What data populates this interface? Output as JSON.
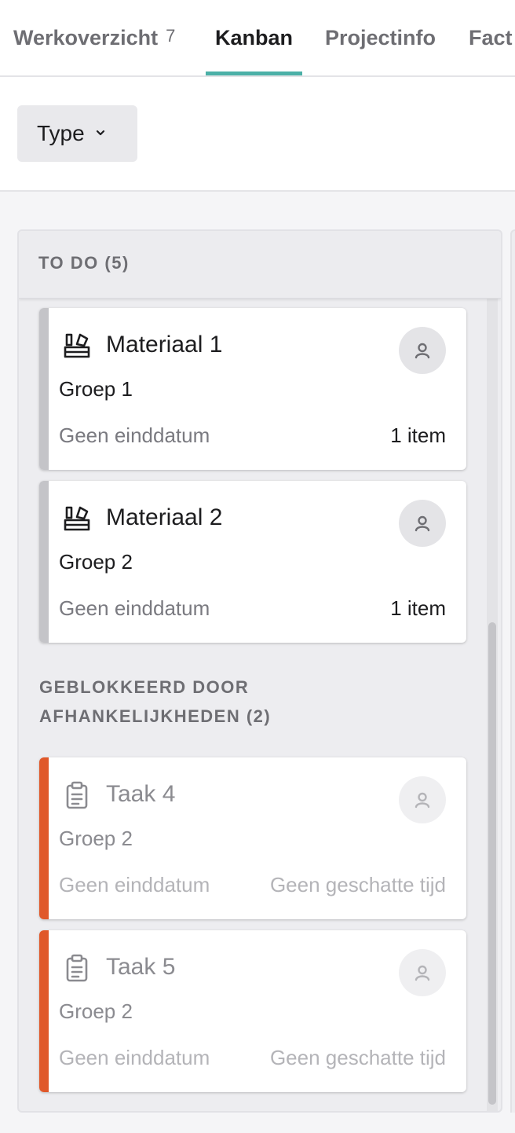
{
  "tabs": [
    {
      "label": "Werkoverzicht",
      "count": "7",
      "active": false
    },
    {
      "label": "Kanban",
      "count": "",
      "active": true
    },
    {
      "label": "Projectinfo",
      "count": "",
      "active": false
    },
    {
      "label": "Fact",
      "count": "",
      "active": false
    }
  ],
  "filter": {
    "type_label": "Type"
  },
  "column": {
    "title": "TO DO (5)",
    "blocked_section": "GEBLOKKEERD DOOR AFHANKELIJKHEDEN (2)"
  },
  "cards": [
    {
      "icon": "material-icon",
      "title": "Materiaal 1",
      "group": "Groep 1",
      "due": "Geen einddatum",
      "meta": "1 item",
      "blocked": false
    },
    {
      "icon": "material-icon",
      "title": "Materiaal 2",
      "group": "Groep 2",
      "due": "Geen einddatum",
      "meta": "1 item",
      "blocked": false
    },
    {
      "icon": "clipboard-icon",
      "title": "Taak 4",
      "group": "Groep 2",
      "due": "Geen einddatum",
      "meta": "Geen geschatte tijd",
      "blocked": true
    },
    {
      "icon": "clipboard-icon",
      "title": "Taak 5",
      "group": "Groep 2",
      "due": "Geen einddatum",
      "meta": "Geen geschatte tijd",
      "blocked": true
    }
  ],
  "colors": {
    "accent": "#4bb0a7",
    "blocked": "#e0582a",
    "neutral_stripe": "#c4c4c8"
  }
}
